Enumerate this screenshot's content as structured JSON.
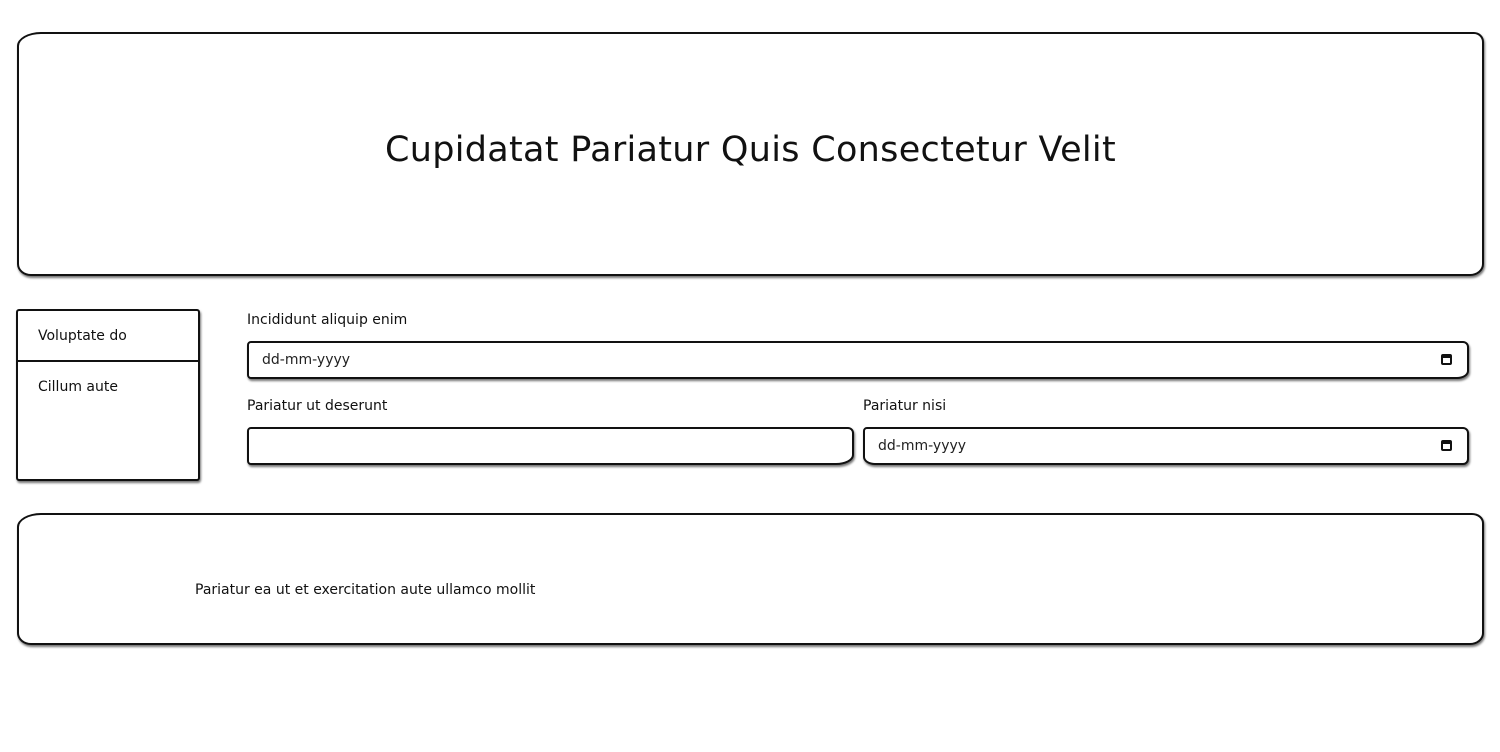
{
  "header": {
    "title": "Cupidatat Pariatur Quis Consectetur Velit"
  },
  "sidebar": {
    "items": [
      {
        "label": "Voluptate do"
      },
      {
        "label": "Cillum aute"
      }
    ]
  },
  "form": {
    "field_1": {
      "label": "Incididunt aliquip enim",
      "placeholder": "dd-mm-yyyy",
      "icon": "calendar-icon"
    },
    "field_2": {
      "label": "Pariatur ut deserunt",
      "value": ""
    },
    "field_3": {
      "label": "Pariatur nisi",
      "placeholder": "dd-mm-yyyy",
      "icon": "calendar-icon"
    }
  },
  "footer": {
    "text": "Pariatur ea ut et exercitation aute ullamco mollit"
  }
}
